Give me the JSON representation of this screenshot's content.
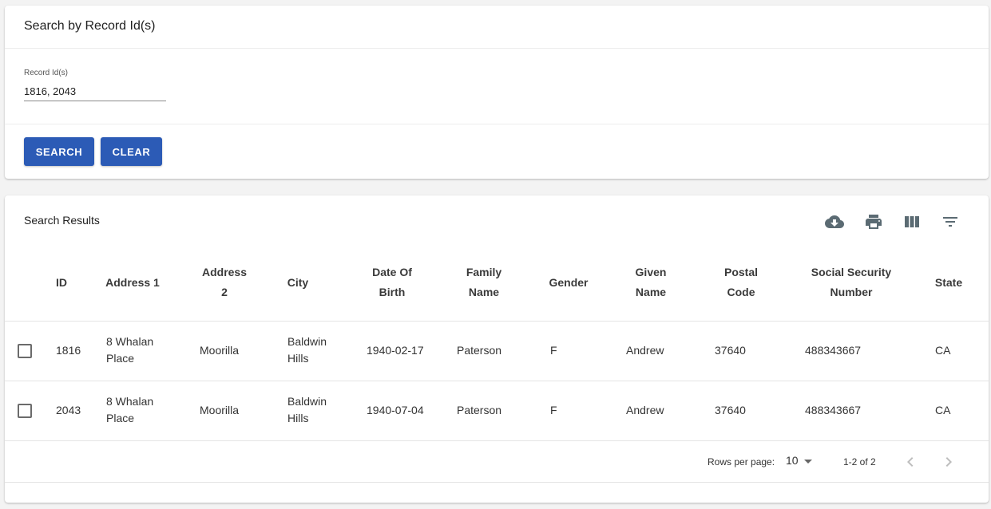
{
  "search_panel": {
    "title": "Search by Record Id(s)",
    "field_label": "Record Id(s)",
    "field_value": "1816, 2043",
    "search_label": "SEARCH",
    "clear_label": "CLEAR",
    "accent_color": "#2c5bb6"
  },
  "results_panel": {
    "title": "Search Results",
    "toolbar_icons": [
      "cloud-download-icon",
      "print-icon",
      "view-columns-icon",
      "filter-icon"
    ],
    "columns": [
      {
        "line1": "ID",
        "line2": ""
      },
      {
        "line1": "Address 1",
        "line2": ""
      },
      {
        "line1": "Address",
        "line2": "2"
      },
      {
        "line1": "City",
        "line2": ""
      },
      {
        "line1": "Date Of",
        "line2": "Birth"
      },
      {
        "line1": "Family",
        "line2": "Name"
      },
      {
        "line1": "Gender",
        "line2": ""
      },
      {
        "line1": "Given",
        "line2": "Name"
      },
      {
        "line1": "Postal",
        "line2": "Code"
      },
      {
        "line1": "Social Security",
        "line2": "Number"
      },
      {
        "line1": "State",
        "line2": ""
      }
    ],
    "rows": [
      {
        "id": "1816",
        "address1_line1": "8 Whalan",
        "address1_line2": "Place",
        "address2": "Moorilla",
        "city_line1": "Baldwin",
        "city_line2": "Hills",
        "dob": "1940-02-17",
        "family_name": "Paterson",
        "gender": "F",
        "given_name": "Andrew",
        "postal_code": "37640",
        "ssn": "488343667",
        "state": "CA"
      },
      {
        "id": "2043",
        "address1_line1": "8 Whalan",
        "address1_line2": "Place",
        "address2": "Moorilla",
        "city_line1": "Baldwin",
        "city_line2": "Hills",
        "dob": "1940-07-04",
        "family_name": "Paterson",
        "gender": "F",
        "given_name": "Andrew",
        "postal_code": "37640",
        "ssn": "488343667",
        "state": "CA"
      }
    ],
    "pagination": {
      "rows_per_page_label": "Rows per page:",
      "rows_per_page_value": "10",
      "range_text": "1-2 of 2",
      "prev_icon": "chevron-left-icon",
      "next_icon": "chevron-right-icon"
    }
  }
}
